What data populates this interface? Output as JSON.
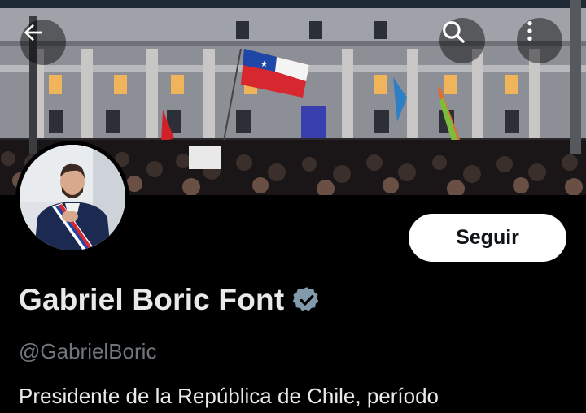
{
  "profile": {
    "display_name": "Gabriel Boric Font",
    "handle": "@GabrielBoric",
    "bio": "Presidente de la República de Chile, período",
    "follow_label": "Seguir",
    "verified_badge": "verified-badge-icon"
  },
  "header": {
    "back_icon": "arrow-left-icon",
    "search_icon": "search-icon",
    "more_icon": "more-vertical-icon"
  },
  "colors": {
    "background": "#000000",
    "name_text": "#e7e9ea",
    "handle_text": "#71767b",
    "follow_bg": "#ffffff",
    "badge": "#829aab"
  }
}
